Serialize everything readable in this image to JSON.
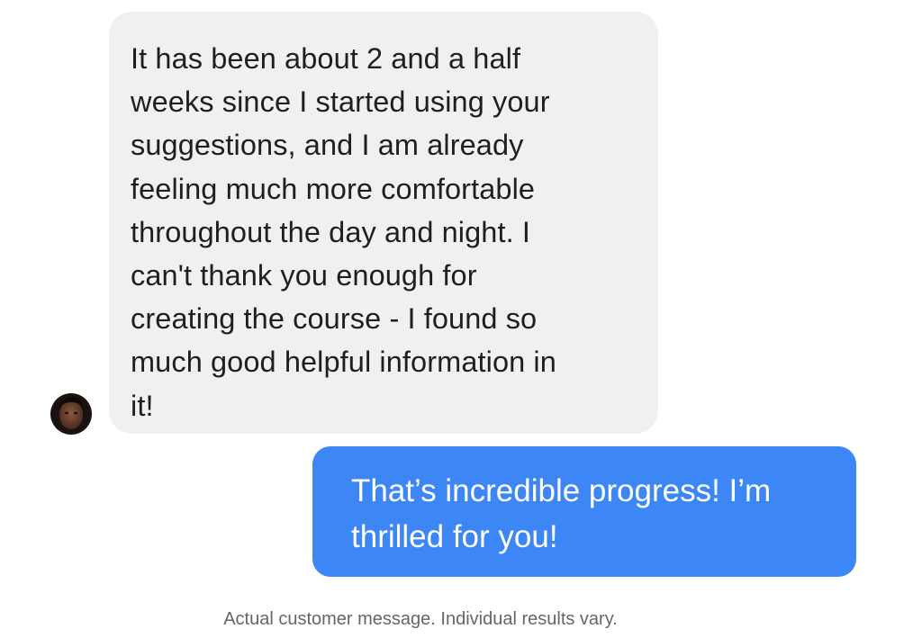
{
  "conversation": {
    "incoming": {
      "lines": [
        "It has been about 2 and a half",
        "weeks since I started using your",
        "suggestions, and I am already",
        "feeling much more comfortable",
        "throughout the day and night. I",
        "can't thank you enough for",
        "creating the course - I found so",
        "much good helpful information in",
        "it!"
      ]
    },
    "outgoing": {
      "lines": [
        "That’s incredible progress! I’m",
        "thrilled for you!"
      ]
    }
  },
  "footer": {
    "disclaimer": "Actual customer message. Individual results vary."
  },
  "colors": {
    "incoming_bubble": "#f0f0f0",
    "outgoing_bubble": "#3d86f5",
    "disclaimer_text": "#666666"
  },
  "icons": {
    "avatar": "customer-avatar"
  }
}
